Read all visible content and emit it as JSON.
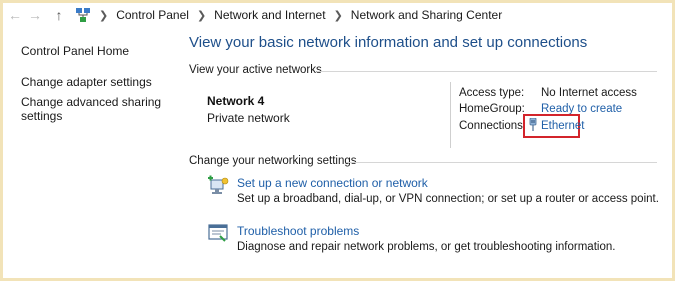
{
  "breadcrumb": {
    "items": [
      "Control Panel",
      "Network and Internet",
      "Network and Sharing Center"
    ]
  },
  "icons": {
    "back": "back-arrow-icon",
    "forward": "forward-arrow-icon",
    "up": "up-arrow-icon",
    "location": "network-location-icon"
  },
  "sidebar": {
    "items": [
      {
        "label": "Control Panel Home"
      },
      {
        "label": "Change adapter settings"
      },
      {
        "label": "Change advanced sharing settings"
      }
    ]
  },
  "main": {
    "title": "View your basic network information and set up connections",
    "active_networks_label": "View your active networks",
    "network": {
      "name": "Network  4",
      "category": "Private network",
      "access_type_label": "Access type:",
      "access_type_value": "No Internet access",
      "homegroup_label": "HomeGroup:",
      "homegroup_value": "Ready to create",
      "connections_label": "Connections:",
      "connections_value": "Ethernet"
    },
    "change_settings_label": "Change your networking settings",
    "tasks": [
      {
        "link": "Set up a new connection or network",
        "description": "Set up a broadband, dial-up, or VPN connection; or set up a router or access point."
      },
      {
        "link": "Troubleshoot problems",
        "description": "Diagnose and repair network problems, or get troubleshooting information."
      }
    ]
  },
  "colors": {
    "title_blue": "#1e4f8a",
    "link_blue": "#1f5fa8",
    "highlight_red": "#d3242b",
    "frame_border": "#f2e3b8"
  }
}
